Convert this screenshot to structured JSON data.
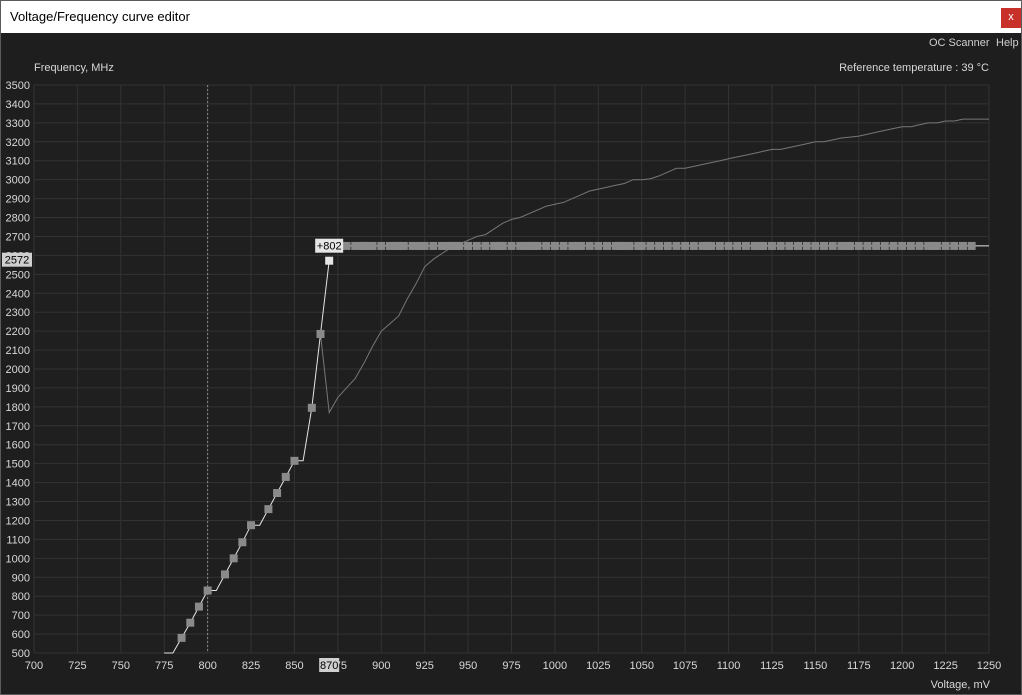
{
  "window": {
    "title": "Voltage/Frequency curve editor",
    "close_glyph": "x"
  },
  "menu": {
    "oc_scanner": "OC Scanner",
    "help": "Help"
  },
  "header": {
    "y_axis_label": "Frequency, MHz",
    "reference_temperature": "Reference temperature : 39 °C"
  },
  "colors": {
    "background": "#1e1e1e",
    "plot_background": "#1f1f1f",
    "grid": "#333333",
    "curve": "#e6e6e6",
    "reference_curve": "#777777",
    "point": "#8a8a8a",
    "selected_point": "#e6e6e6",
    "close_button": "#c8302a"
  },
  "chart_data": {
    "type": "line",
    "xlabel": "Voltage, mV",
    "ylabel": "Frequency, MHz",
    "xlim": [
      700,
      1250
    ],
    "ylim": [
      500,
      3500
    ],
    "x_ticks": [
      700,
      725,
      750,
      775,
      800,
      825,
      850,
      875,
      900,
      925,
      950,
      975,
      1000,
      1025,
      1050,
      1075,
      1100,
      1125,
      1150,
      1175,
      1200,
      1225,
      1250
    ],
    "y_ticks": [
      500,
      600,
      700,
      800,
      900,
      1000,
      1100,
      1200,
      1300,
      1400,
      1500,
      1600,
      1700,
      1800,
      1900,
      2000,
      2100,
      2200,
      2300,
      2400,
      2500,
      2600,
      2700,
      2800,
      2900,
      3000,
      3100,
      3200,
      3300,
      3400,
      3500
    ],
    "grid": true,
    "vertical_marker_x": 800,
    "selected": {
      "voltage_label": "870",
      "frequency_label": "2572",
      "offset_label": "+802",
      "voltage": 870,
      "frequency": 2572
    },
    "series": [
      {
        "x": [
          775,
          780,
          785,
          790,
          795,
          800,
          805,
          810,
          815,
          820,
          825,
          830,
          835,
          840,
          845,
          850,
          855,
          860,
          865,
          870
        ],
        "y": [
          500,
          500,
          580,
          660,
          745,
          830,
          830,
          915,
          1000,
          1085,
          1175,
          1175,
          1260,
          1345,
          1430,
          1515,
          1515,
          1795,
          2185,
          2572
        ]
      },
      {
        "x": [
          865,
          870,
          875,
          880,
          885,
          890,
          895,
          900,
          905,
          910,
          915,
          920,
          925,
          930,
          935,
          940,
          945,
          950,
          955,
          960,
          965,
          970,
          975,
          980,
          985,
          990,
          995,
          1000,
          1005,
          1010,
          1015,
          1020,
          1025,
          1030,
          1035,
          1040,
          1045,
          1050,
          1055,
          1060,
          1065,
          1070,
          1075,
          1080,
          1085,
          1090,
          1095,
          1100,
          1105,
          1110,
          1115,
          1120,
          1125,
          1130,
          1135,
          1140,
          1145,
          1150,
          1155,
          1160,
          1165,
          1170,
          1175,
          1180,
          1185,
          1190,
          1195,
          1200,
          1205,
          1210,
          1215,
          1220,
          1225,
          1230,
          1235,
          1240,
          1245,
          1250
        ],
        "y": [
          2185,
          1770,
          1850,
          1900,
          1950,
          2030,
          2120,
          2200,
          2240,
          2280,
          2370,
          2450,
          2540,
          2580,
          2610,
          2640,
          2660,
          2680,
          2700,
          2710,
          2740,
          2770,
          2790,
          2800,
          2820,
          2840,
          2860,
          2870,
          2880,
          2900,
          2920,
          2940,
          2950,
          2960,
          2970,
          2980,
          3000,
          3000,
          3005,
          3020,
          3040,
          3060,
          3060,
          3070,
          3080,
          3090,
          3100,
          3110,
          3120,
          3130,
          3140,
          3150,
          3160,
          3160,
          3170,
          3180,
          3190,
          3200,
          3200,
          3210,
          3220,
          3225,
          3230,
          3240,
          3250,
          3260,
          3270,
          3280,
          3280,
          3290,
          3300,
          3300,
          3310,
          3310,
          3320,
          3320,
          3320,
          3320
        ]
      },
      {
        "x": [
          870,
          875,
          880,
          885,
          890,
          895,
          900,
          905,
          910,
          915,
          920,
          925,
          930,
          935,
          940,
          945,
          950,
          955,
          960,
          965,
          970,
          975,
          980,
          985,
          990,
          995,
          1000,
          1005,
          1010,
          1015,
          1020,
          1025,
          1030,
          1035,
          1040,
          1045,
          1050,
          1055,
          1060,
          1065,
          1070,
          1075,
          1080,
          1085,
          1090,
          1095,
          1100,
          1105,
          1110,
          1115,
          1120,
          1125,
          1130,
          1135,
          1140,
          1145,
          1150,
          1155,
          1160,
          1165,
          1170,
          1175,
          1180,
          1185,
          1190,
          1195,
          1200,
          1205,
          1210,
          1215,
          1220,
          1225,
          1230,
          1235,
          1240,
          1245,
          1250
        ],
        "y": [
          2650,
          2650,
          2650,
          2650,
          2650,
          2650,
          2650,
          2650,
          2650,
          2650,
          2650,
          2650,
          2650,
          2650,
          2650,
          2650,
          2650,
          2650,
          2650,
          2650,
          2650,
          2650,
          2650,
          2650,
          2650,
          2650,
          2650,
          2650,
          2650,
          2650,
          2650,
          2650,
          2650,
          2650,
          2650,
          2650,
          2650,
          2650,
          2650,
          2650,
          2650,
          2650,
          2650,
          2650,
          2650,
          2650,
          2650,
          2650,
          2650,
          2650,
          2650,
          2650,
          2650,
          2650,
          2650,
          2650,
          2650,
          2650,
          2650,
          2650,
          2650,
          2650,
          2650,
          2650,
          2650,
          2650,
          2650,
          2650,
          2650,
          2650,
          2650,
          2650,
          2650,
          2650,
          2650,
          2650,
          2650
        ]
      }
    ],
    "points": {
      "x": [
        785,
        790,
        795,
        800,
        810,
        815,
        820,
        825,
        835,
        840,
        845,
        850,
        860,
        865,
        870,
        880,
        885,
        888,
        890,
        893,
        895,
        900,
        905,
        908,
        910,
        913,
        918,
        922,
        925,
        930,
        935,
        938,
        940,
        943,
        945,
        950,
        955,
        960,
        965,
        968,
        970,
        975,
        980,
        983,
        985,
        988,
        990,
        995,
        1000,
        1005,
        1010,
        1013,
        1015,
        1020,
        1025,
        1030,
        1035,
        1038,
        1040,
        1043,
        1048,
        1050,
        1055,
        1060,
        1065,
        1070,
        1075,
        1080,
        1085,
        1088,
        1090,
        1095,
        1100,
        1105,
        1110,
        1115,
        1118,
        1120,
        1125,
        1130,
        1135,
        1140,
        1145,
        1150,
        1155,
        1160,
        1165,
        1168,
        1170,
        1175,
        1180,
        1185,
        1190,
        1195,
        1200,
        1205,
        1210,
        1215,
        1218,
        1220,
        1225,
        1230,
        1235,
        1240
      ],
      "y": [
        580,
        660,
        745,
        830,
        915,
        1000,
        1085,
        1175,
        1260,
        1345,
        1430,
        1515,
        1795,
        2185,
        2572,
        2650,
        2650,
        2650,
        2650,
        2650,
        2650,
        2650,
        2650,
        2650,
        2650,
        2650,
        2650,
        2650,
        2650,
        2650,
        2650,
        2650,
        2650,
        2650,
        2650,
        2650,
        2650,
        2650,
        2650,
        2650,
        2650,
        2650,
        2650,
        2650,
        2650,
        2650,
        2650,
        2650,
        2650,
        2650,
        2650,
        2650,
        2650,
        2650,
        2650,
        2650,
        2650,
        2650,
        2650,
        2650,
        2650,
        2650,
        2650,
        2650,
        2650,
        2650,
        2650,
        2650,
        2650,
        2650,
        2650,
        2650,
        2650,
        2650,
        2650,
        2650,
        2650,
        2650,
        2650,
        2650,
        2650,
        2650,
        2650,
        2650,
        2650,
        2650,
        2650,
        2650,
        2650,
        2650,
        2650,
        2650,
        2650,
        2650,
        2650,
        2650,
        2650,
        2650,
        2650,
        2650,
        2650,
        2650,
        2650,
        2650
      ]
    }
  }
}
